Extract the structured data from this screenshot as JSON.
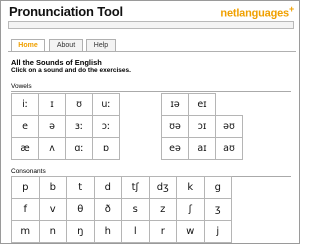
{
  "app": {
    "title": "Pronunciation Tool",
    "brand": "netlanguages",
    "brand_mark": "+"
  },
  "tabs": [
    {
      "label": "Home",
      "active": true
    },
    {
      "label": "About",
      "active": false
    },
    {
      "label": "Help",
      "active": false
    }
  ],
  "content": {
    "heading": "All the Sounds of English",
    "instruction": "Click on a sound and do the exercises.",
    "vowels_label": "Vowels",
    "consonants_label": "Consonants"
  },
  "vowels_left": [
    [
      "iː",
      "ɪ",
      "ʊ",
      "uː"
    ],
    [
      "e",
      "ə",
      "ɜː",
      "ɔː"
    ],
    [
      "æ",
      "ʌ",
      "ɑː",
      "ɒ"
    ]
  ],
  "vowels_right": [
    [
      "ɪə",
      "eɪ",
      ""
    ],
    [
      "ʊə",
      "ɔɪ",
      "əʊ"
    ],
    [
      "eə",
      "aɪ",
      "aʊ"
    ]
  ],
  "consonants": [
    [
      "p",
      "b",
      "t",
      "d",
      "tʃ",
      "dʒ",
      "k",
      "g"
    ],
    [
      "f",
      "v",
      "θ",
      "ð",
      "s",
      "z",
      "ʃ",
      "ʒ"
    ],
    [
      "m",
      "n",
      "ŋ",
      "h",
      "l",
      "r",
      "w",
      "j"
    ]
  ],
  "colors": {
    "accent": "#f0a000",
    "border": "#b5b5b5",
    "text": "#111111"
  }
}
